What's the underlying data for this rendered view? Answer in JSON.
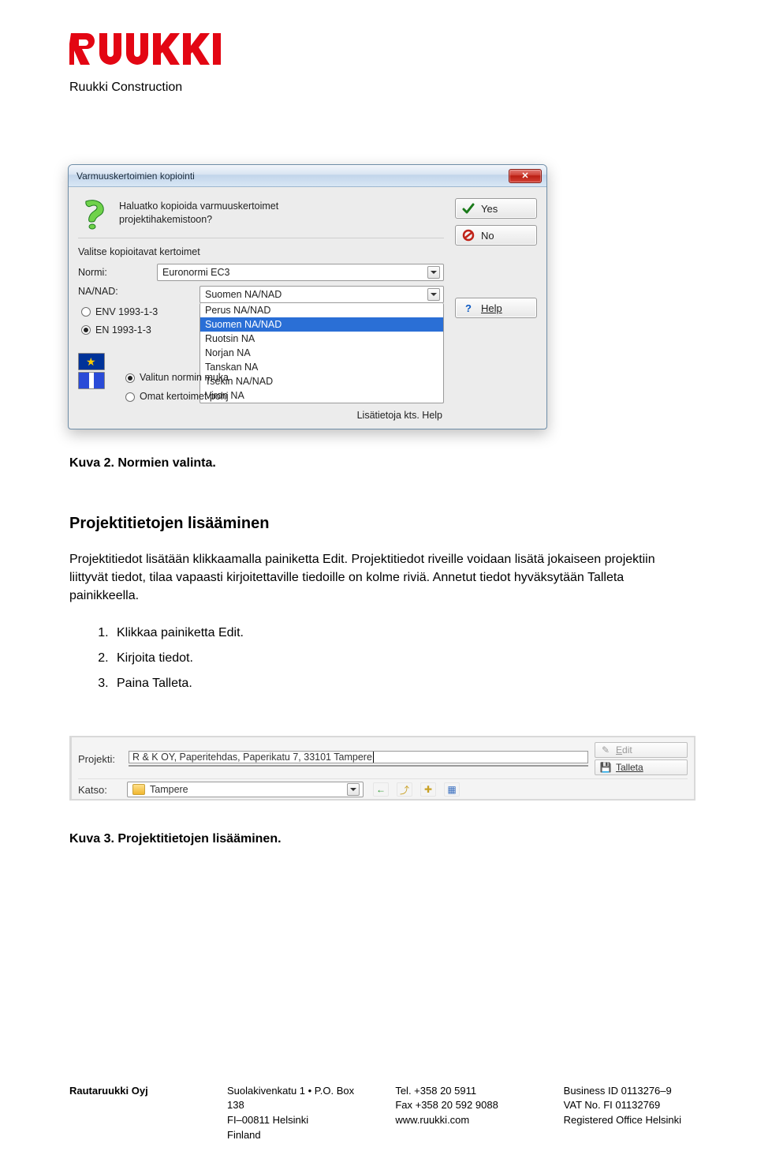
{
  "header": {
    "logo_text": "RUUKKI",
    "subbrand": "Ruukki Construction"
  },
  "dialog": {
    "title": "Varmuuskertoimien kopiointi",
    "prompt_line1": "Haluatko kopioida varmuuskertoimet",
    "prompt_line2": "projektihakemistoon?",
    "group_label": "Valitse kopioitavat kertoimet",
    "normi_label": "Normi:",
    "normi_value": "Euronormi EC3",
    "nanad_label": "NA/NAD:",
    "nanad_value": "Suomen NA/NAD",
    "env_label": "ENV 1993-1-3",
    "en_label": "EN 1993-1-3",
    "listbox": {
      "items": [
        "Perus NA/NAD",
        "Suomen NA/NAD",
        "Ruotsin NA",
        "Norjan NA",
        "Tanskan NA",
        "Tsekin NA/NAD",
        "Viron NA"
      ],
      "selected_index": 1
    },
    "opt_selected_norm": "Valitun normin muka",
    "opt_own": "Omat kertoimet pohj",
    "footer_help": "Lisätietoja kts. Help",
    "btn_yes": "Yes",
    "btn_no": "No",
    "btn_help": "Help"
  },
  "body": {
    "caption1": "Kuva 2. Normien valinta.",
    "h2": "Projektitietojen lisääminen",
    "para": "Projektitiedot lisätään klikkaamalla painiketta Edit. Projektitiedot riveille voidaan lisätä jokaiseen projektiin liittyvät tiedot, tilaa vapaasti kirjoitettaville tiedoille on kolme riviä. Annetut tiedot hyväksytään Talleta painikkeella.",
    "steps": {
      "s1": "Klikkaa painiketta Edit.",
      "s2": "Kirjoita tiedot.",
      "s3": "Paina Talleta."
    }
  },
  "projbar": {
    "label": "Projekti:",
    "value": "R & K OY, Paperitehdas, Paperikatu 7, 33101 Tampere",
    "btn_edit": "Edit",
    "btn_save": "Talleta",
    "katso_label": "Katso:",
    "folder_value": "Tampere"
  },
  "caption2": "Kuva 3. Projektitietojen lisääminen.",
  "footer": {
    "company": "Rautaruukki Oyj",
    "addr1": "Suolakivenkatu 1 • P.O. Box 138",
    "addr2": "FI–00811 Helsinki",
    "addr3": "Finland",
    "tel": "Tel. +358 20 5911",
    "fax": "Fax +358 20 592 9088",
    "web": "www.ruukki.com",
    "biz": "Business ID 0113276–9",
    "vat": "VAT No. FI 01132769",
    "office": "Registered Office Helsinki"
  }
}
